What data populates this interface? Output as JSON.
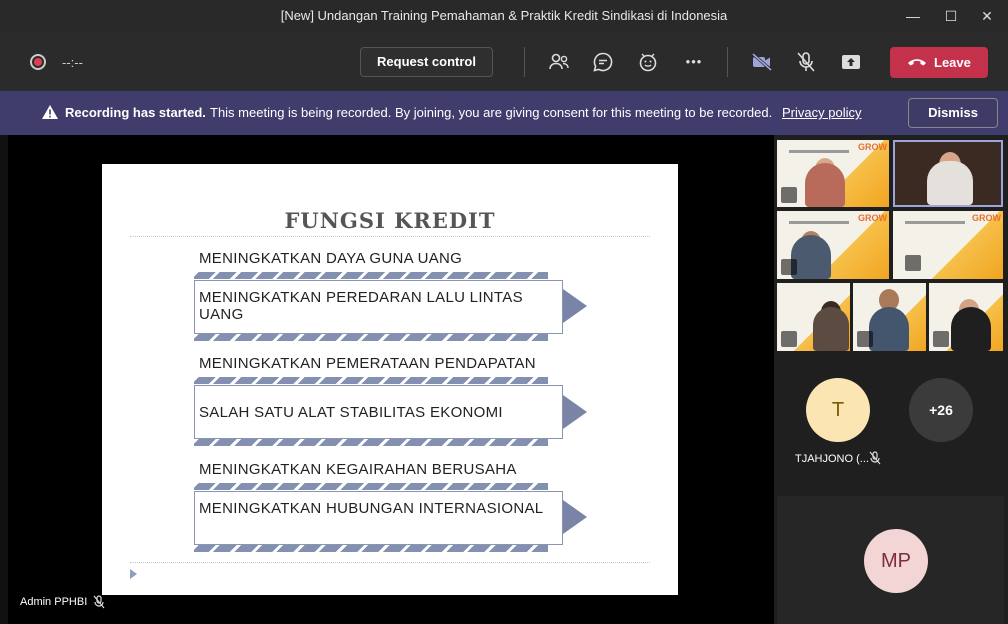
{
  "window": {
    "title": "[New] Undangan Training Pemahaman & Praktik Kredit Sindikasi di Indonesia",
    "minimize_glyph": "—",
    "maximize_glyph": "☐",
    "close_glyph": "✕"
  },
  "toolbar": {
    "recording_icon": "record-icon",
    "timer": "--:--",
    "request_control_label": "Request control",
    "people_icon": "people-icon",
    "chat_icon": "chat-icon",
    "reactions_icon": "reactions-icon",
    "more_icon": "more-icon",
    "more_glyph": "•••",
    "camera_icon": "camera-off-icon",
    "mic_icon": "mic-off-icon",
    "share_icon": "share-icon",
    "leave_label": "Leave"
  },
  "banner": {
    "bold_text": "Recording has started.",
    "message": "This meeting is being recorded. By joining, you are giving consent for this meeting to be recorded.",
    "link_text": "Privacy policy",
    "dismiss_label": "Dismiss"
  },
  "slide": {
    "title": "FUNGSI KREDIT",
    "groups": [
      {
        "header": "MENINGKATKAN DAYA GUNA UANG",
        "box": "MENINGKATKAN PEREDARAN LALU LINTAS UANG"
      },
      {
        "header": "MENINGKATKAN PEMERATAAN PENDAPATAN",
        "box": "SALAH SATU ALAT STABILITAS EKONOMI"
      },
      {
        "header": "MENINGKATKAN KEGAIRAHAN BERUSAHA",
        "box": "MENINGKATKAN HUBUNGAN INTERNASIONAL"
      }
    ]
  },
  "presenter": {
    "name": "Admin PPHBI"
  },
  "participants": {
    "tile_brand": "GROW",
    "tj_initial": "T",
    "tj_name": "TJAHJONO (...",
    "more_count": "+26",
    "mp_initials": "MP"
  },
  "colors": {
    "leave": "#c4314b",
    "banner": "#403d6d",
    "accent": "#7a84a6"
  }
}
